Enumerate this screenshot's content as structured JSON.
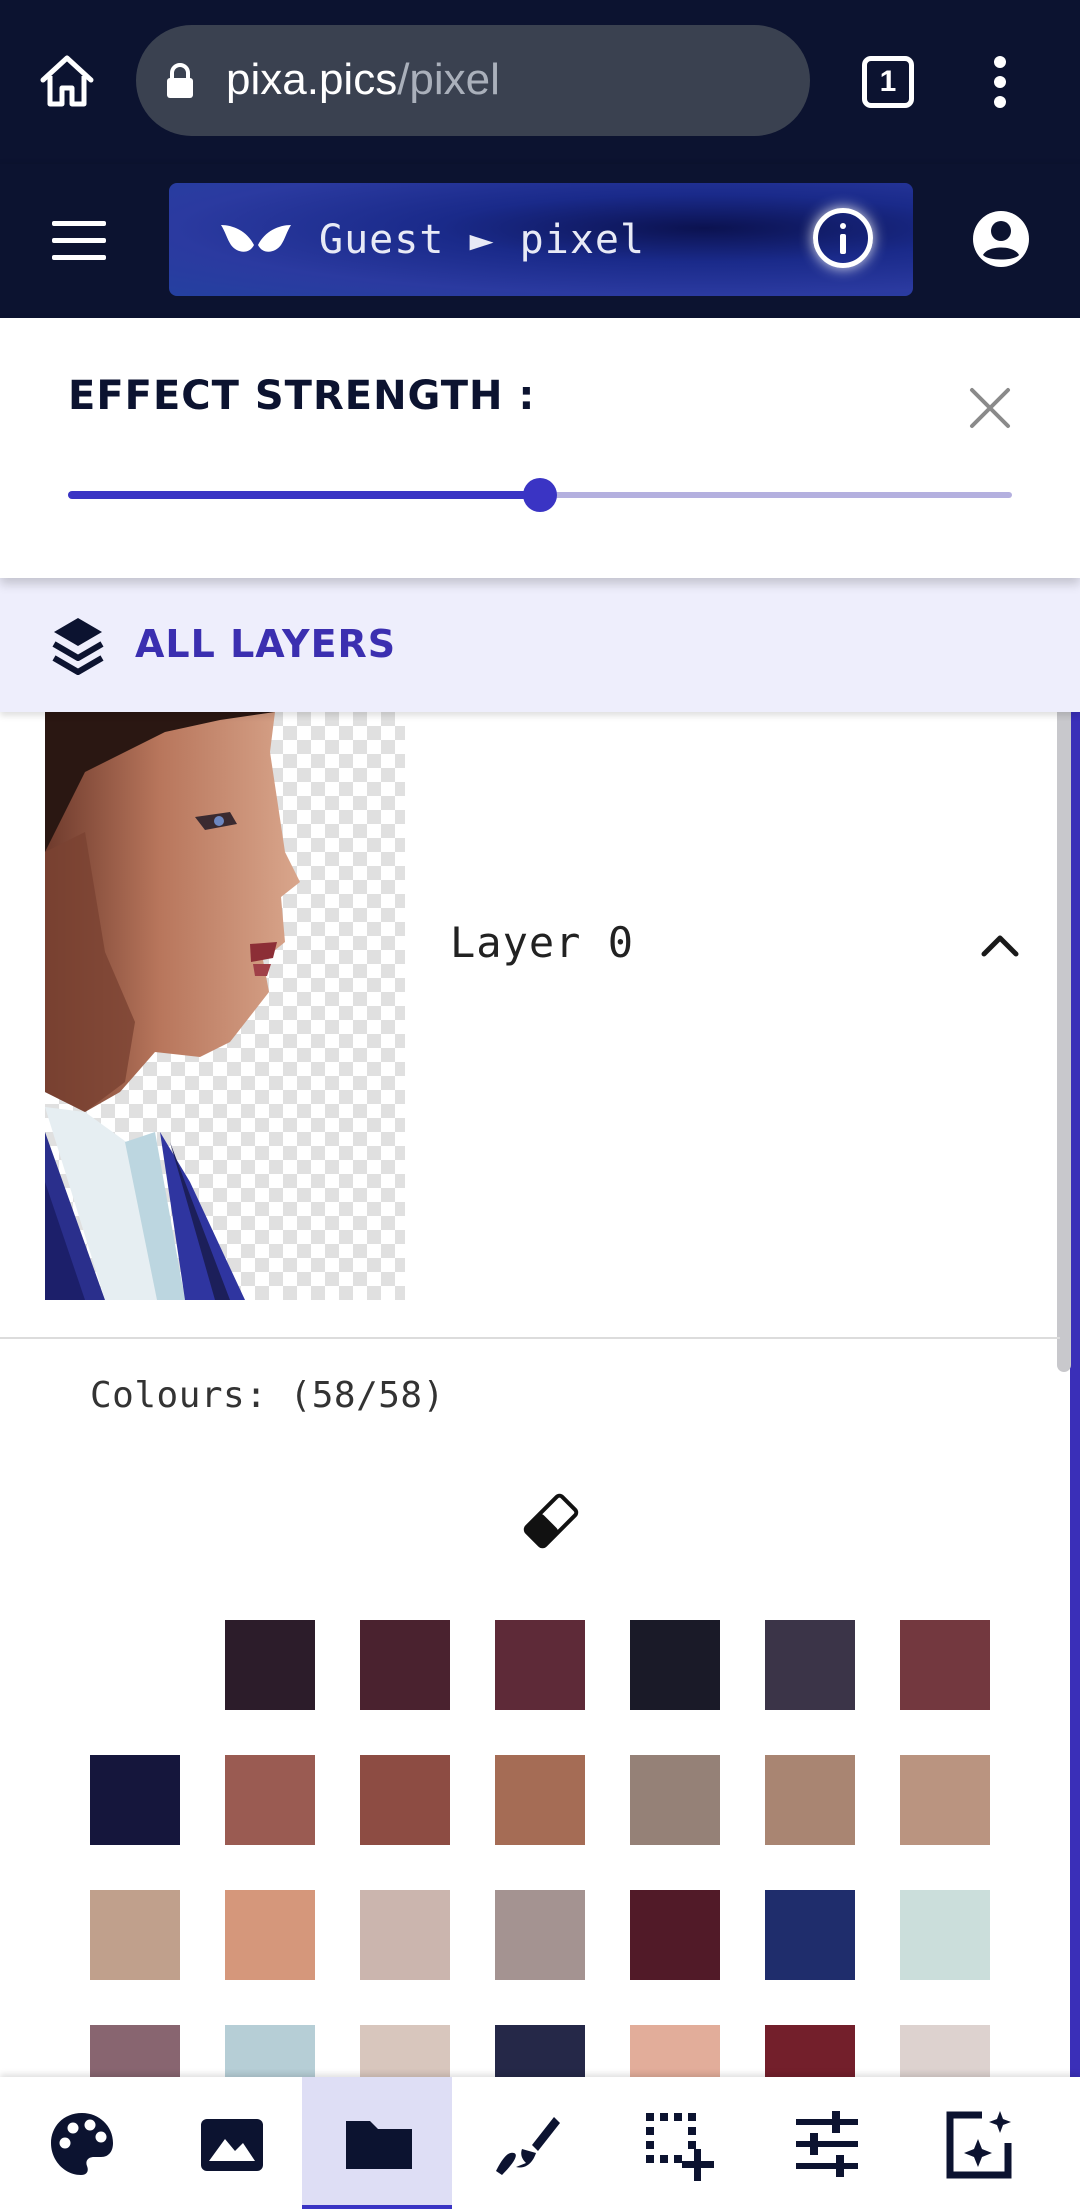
{
  "browser": {
    "url_host": "pixa.pics",
    "url_path": "/pixel",
    "tab_count": "1"
  },
  "header": {
    "title": "Guest ► pixel"
  },
  "effect": {
    "label": "EFFECT STRENGTH :",
    "strength_fraction": 0.5
  },
  "layers": {
    "all_label": "ALL LAYERS",
    "items": [
      {
        "name": "Layer 0"
      }
    ]
  },
  "palette": {
    "label": "Colours: (58/58)",
    "colors": [
      "#2c1c2a",
      "#4a222f",
      "#5e2a38",
      "#1a1a28",
      "#3b3448",
      "#73383f",
      "#15163c",
      "#9a5b52",
      "#8d4c43",
      "#a56c55",
      "#958177",
      "#a98572",
      "#ba9480",
      "#c0a08c",
      "#d5977b",
      "#cbb5ae",
      "#a49391",
      "#511a28",
      "#1f2d6c",
      "#cbdedb",
      "#886570",
      "#b6ced6",
      "#d8c6bd",
      "#252848",
      "#e2ad9a",
      "#731f2b",
      "#ddd2cf"
    ]
  },
  "nav": {
    "items": [
      "palette",
      "image",
      "folder",
      "brush",
      "select-add",
      "tune",
      "magic"
    ],
    "active": "folder"
  }
}
